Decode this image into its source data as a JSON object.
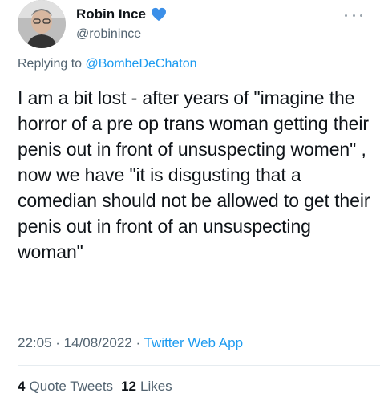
{
  "author": {
    "display_name": "Robin Ince",
    "handle": "@robinince",
    "badge_icon": "blue-heart-icon",
    "badge_color": "#3b8fe8"
  },
  "reply": {
    "prefix": "Replying to ",
    "mention": "@BombeDeChaton"
  },
  "tweet": {
    "text": "I am a bit lost - after years of \"imagine the horror of a pre op trans woman getting their penis out in front of unsuspecting women\" , now we have \"it is disgusting that a comedian should not be allowed to get their penis out in front of an unsuspecting woman\""
  },
  "meta": {
    "time": "22:05",
    "sep1": " · ",
    "date": "14/08/2022",
    "sep2": " · ",
    "source": "Twitter Web App"
  },
  "stats": {
    "quote_count": "4",
    "quote_label": "Quote Tweets",
    "like_count": "12",
    "like_label": "Likes"
  },
  "colors": {
    "text": "#0f1419",
    "secondary": "#536471",
    "link": "#1d9bf0"
  }
}
